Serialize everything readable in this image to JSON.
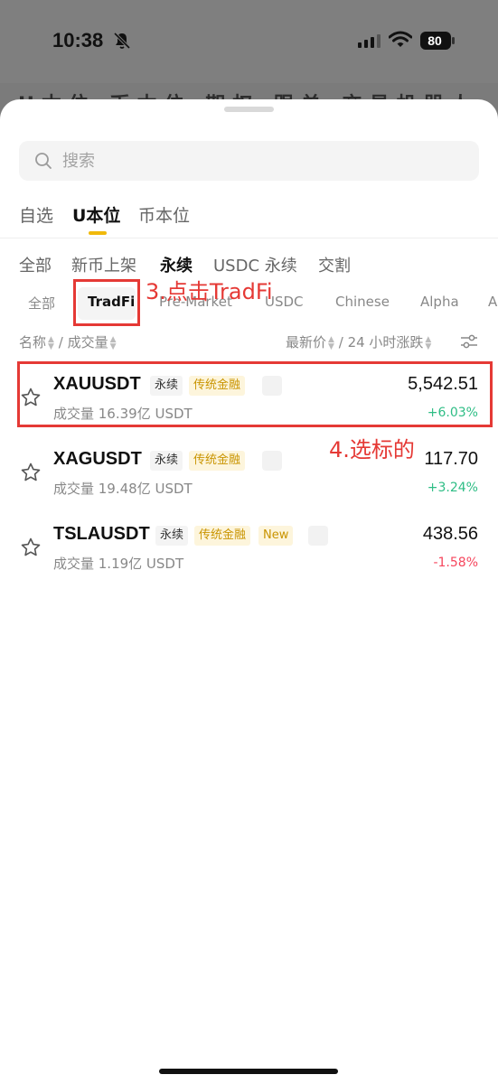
{
  "status": {
    "time": "10:38",
    "battery": "80"
  },
  "background_tabs": "U本位 币本位 期权 跟单 交易机器人",
  "search": {
    "placeholder": "搜索"
  },
  "main_tabs": [
    "自选",
    "U本位",
    "币本位"
  ],
  "sub_tabs": [
    "全部",
    "新币上架",
    "永续",
    "USDC 永续",
    "交割"
  ],
  "chips": [
    "全部",
    "TradFi",
    "Pre-Market",
    "USDC",
    "Chinese",
    "Alpha",
    "A"
  ],
  "columns": {
    "name": "名称",
    "sep": "/",
    "volume": "成交量",
    "price": "最新价",
    "sep2": "/",
    "change": "24 小时涨跌"
  },
  "rows": [
    {
      "symbol": "XAUUSDT",
      "type": "永续",
      "tag": "传统金融",
      "volume": "成交量 16.39亿 USDT",
      "price": "5,542.51",
      "change": "+6.03%"
    },
    {
      "symbol": "XAGUSDT",
      "type": "永续",
      "tag": "传统金融",
      "volume": "成交量 19.48亿 USDT",
      "price": "117.70",
      "change": "+3.24%"
    },
    {
      "symbol": "TSLAUSDT",
      "type": "永续",
      "tag": "传统金融",
      "new_tag": "New",
      "volume": "成交量 1.19亿 USDT",
      "price": "438.56",
      "change": "-1.58%"
    }
  ],
  "annotations": {
    "step3": "3.点击TradFi",
    "step4": "4.选标的"
  },
  "colors": {
    "accent": "#f0b90b",
    "up": "#2ebd85",
    "down": "#f6465d",
    "annotation": "#e53935"
  }
}
